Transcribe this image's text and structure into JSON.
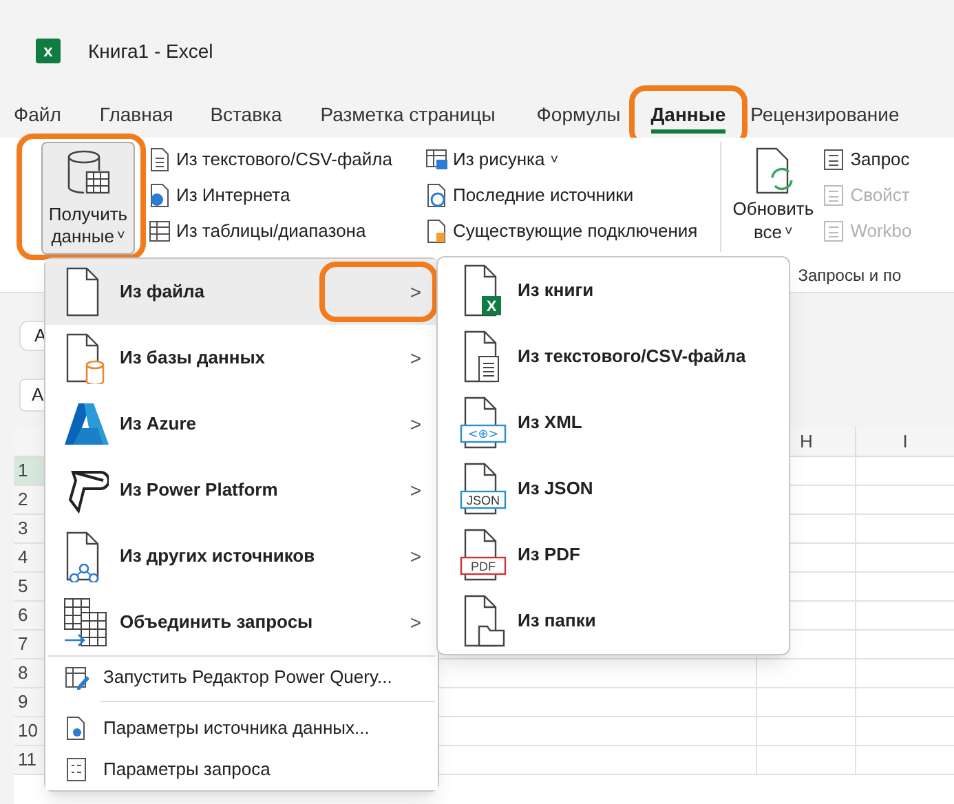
{
  "window": {
    "logo": "x",
    "title": "Книга1  -  Excel"
  },
  "tabs": [
    {
      "label": "Файл",
      "selected": false,
      "highlighted": false
    },
    {
      "label": "Главная",
      "selected": false,
      "highlighted": false
    },
    {
      "label": "Вставка",
      "selected": false,
      "highlighted": false
    },
    {
      "label": "Разметка страницы",
      "selected": false,
      "highlighted": false
    },
    {
      "label": "Формулы",
      "selected": false,
      "highlighted": false
    },
    {
      "label": "Данные",
      "selected": true,
      "highlighted": true
    },
    {
      "label": "Рецензирование",
      "selected": false,
      "highlighted": false
    }
  ],
  "ribbon": {
    "get_data": {
      "label_1": "Получить",
      "label_2": "данные",
      "caret": "˅",
      "highlighted": true
    },
    "commands_1": [
      {
        "label": "Из текстового/CSV-файла"
      },
      {
        "label": "Из Интернета"
      },
      {
        "label": "Из таблицы/диапазона"
      }
    ],
    "commands_2": [
      {
        "label": "Из рисунка",
        "caret": "˅"
      },
      {
        "label": "Последние источники"
      },
      {
        "label": "Существующие подключения"
      }
    ],
    "refresh": {
      "label_1": "Обновить",
      "label_2": "все",
      "caret": "˅"
    },
    "commands_3": [
      {
        "label": "Запрос",
        "disabled": false
      },
      {
        "label": "Свойст",
        "disabled": true
      },
      {
        "label": "Workbo",
        "disabled": true
      }
    ],
    "group_label": "Запросы и по"
  },
  "sheet": {
    "name_box": "A",
    "formula_row": "A",
    "columns": [
      "H",
      "I"
    ],
    "rows": [
      "1",
      "2",
      "3",
      "4",
      "5",
      "6",
      "7",
      "8",
      "9",
      "10",
      "11"
    ]
  },
  "menu": {
    "items": [
      {
        "kind": "sub",
        "label": "Из файла",
        "selected": true,
        "highlighted": true
      },
      {
        "kind": "sub",
        "label": "Из базы данных",
        "selected": false,
        "highlighted": false
      },
      {
        "kind": "sub",
        "label": "Из Azure",
        "selected": false,
        "highlighted": false
      },
      {
        "kind": "sub",
        "label": "Из Power Platform",
        "selected": false,
        "highlighted": false
      },
      {
        "kind": "sub",
        "label": "Из других источников",
        "selected": false,
        "highlighted": false
      },
      {
        "kind": "sub",
        "label": "Объединить запросы",
        "selected": false,
        "highlighted": false
      },
      {
        "kind": "small",
        "label": "Запустить Редактор Power Query...",
        "selected": false
      },
      {
        "kind": "small",
        "label": "Параметры источника данных...",
        "selected": false
      },
      {
        "kind": "small",
        "label": "Параметры запроса",
        "selected": false
      }
    ],
    "chevron": ">"
  },
  "submenu": {
    "items": [
      {
        "label": "Из книги",
        "badge": "X"
      },
      {
        "label": "Из текстового/CSV-файла"
      },
      {
        "label": "Из XML",
        "badge": "<⊕>"
      },
      {
        "label": "Из JSON",
        "badge": "JSON"
      },
      {
        "label": "Из PDF",
        "badge": "PDF"
      },
      {
        "label": "Из папки"
      }
    ]
  }
}
